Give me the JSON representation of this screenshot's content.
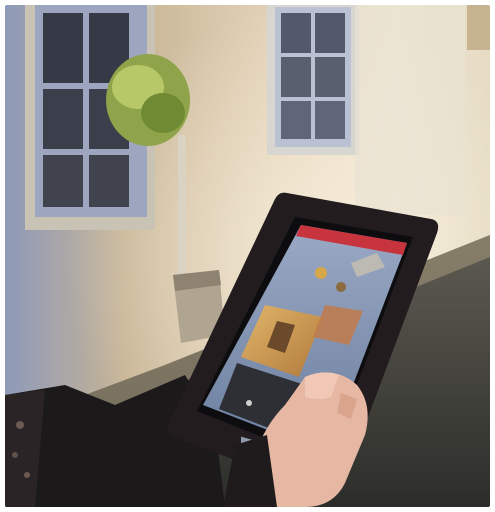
{
  "scene": {
    "subject": "hand-holding-tablet",
    "setting": "courtyard-facade-at-dusk"
  },
  "tablet_screen": {
    "header_color": "#c8343e",
    "header_text": ""
  },
  "colors": {
    "wall": "#c9b08a",
    "window_frame": "#cfd6e2",
    "tablet_case": "#2a2224",
    "ground": "#4a4b45",
    "sky_in_screen": "#8fa1bf"
  }
}
